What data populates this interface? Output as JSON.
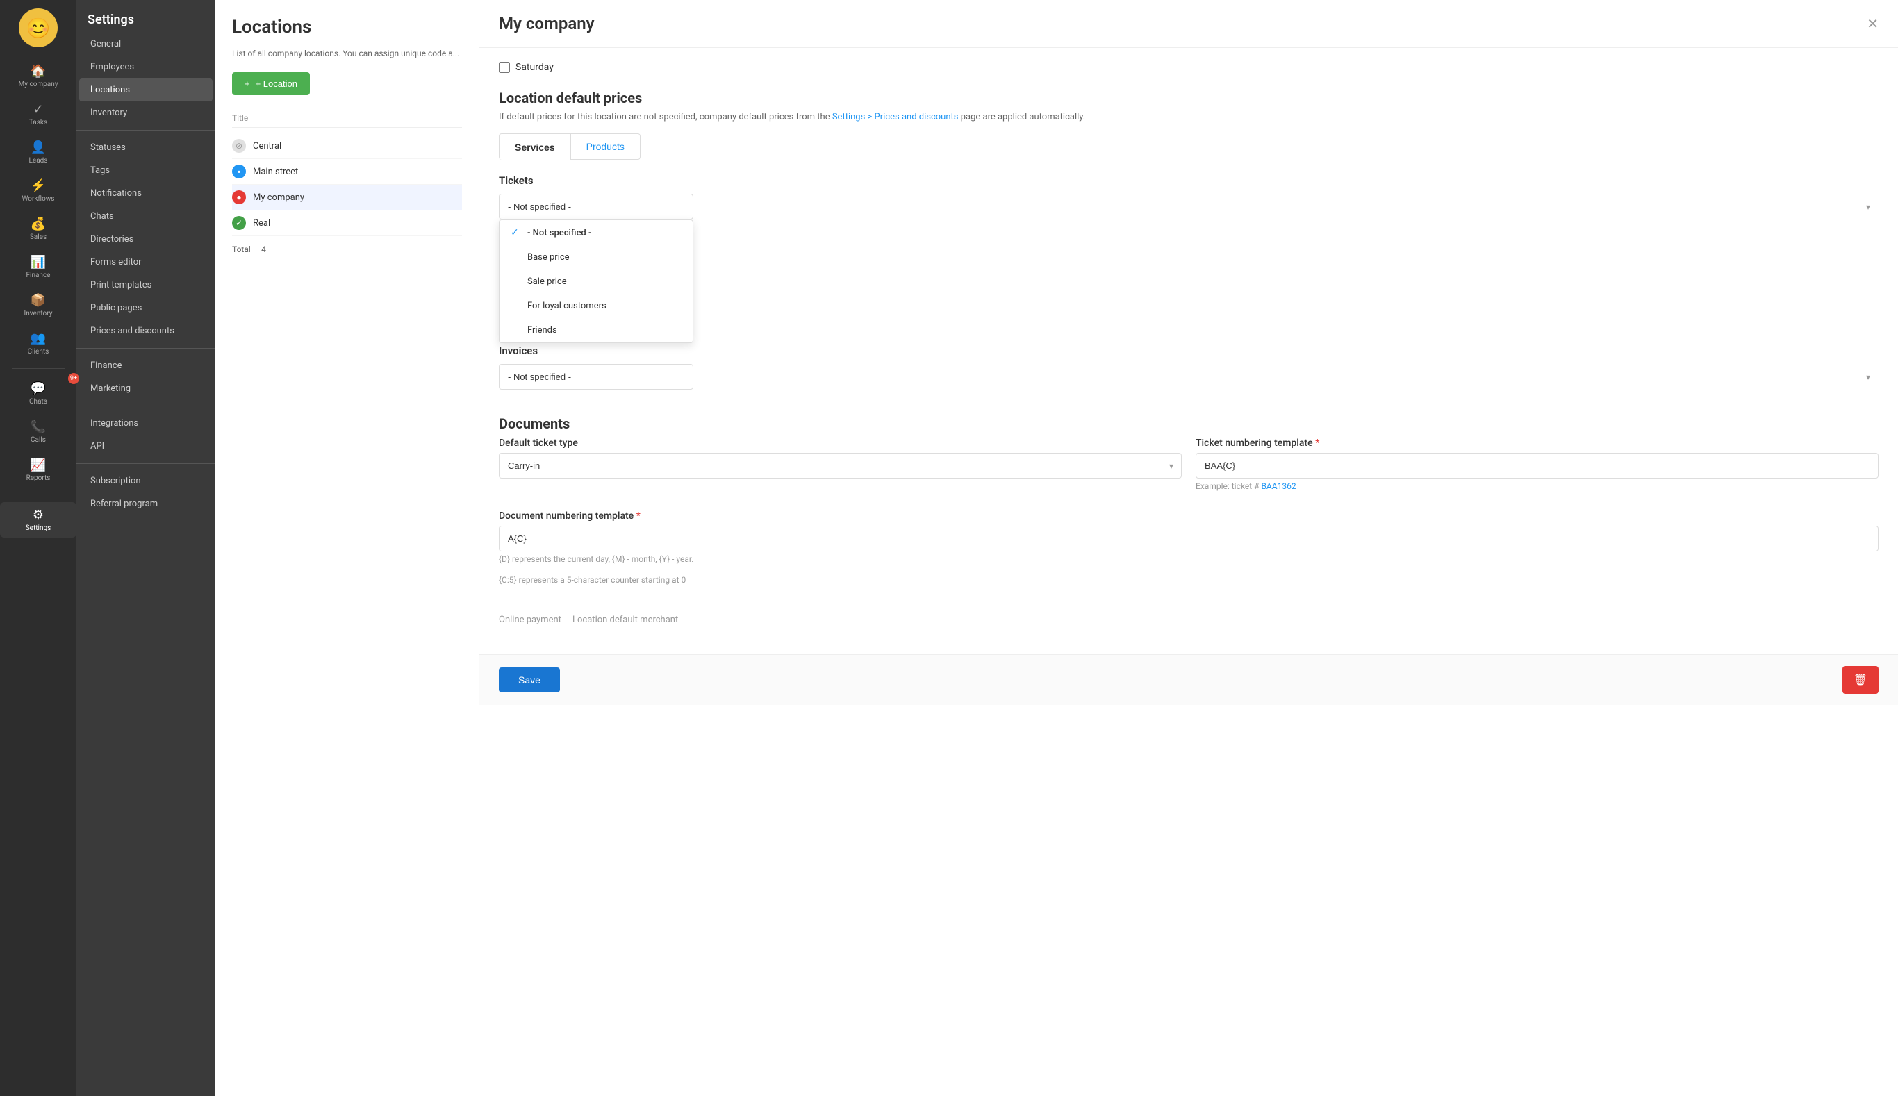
{
  "leftNav": {
    "avatar": "😊",
    "items": [
      {
        "id": "my-company",
        "label": "My company",
        "icon": "🏠",
        "active": false
      },
      {
        "id": "tasks",
        "label": "Tasks",
        "icon": "✓",
        "active": false
      },
      {
        "id": "leads",
        "label": "Leads",
        "icon": "👤",
        "active": false
      },
      {
        "id": "workflows",
        "label": "Workflows",
        "icon": "⚡",
        "active": false
      },
      {
        "id": "sales",
        "label": "Sales",
        "icon": "💰",
        "active": false
      },
      {
        "id": "finance",
        "label": "Finance",
        "icon": "📊",
        "active": false
      },
      {
        "id": "inventory",
        "label": "Inventory",
        "icon": "📦",
        "active": false
      },
      {
        "id": "clients",
        "label": "Clients",
        "icon": "👥",
        "active": false
      },
      {
        "id": "chats",
        "label": "Chats",
        "icon": "💬",
        "active": false,
        "badge": "9+"
      },
      {
        "id": "calls",
        "label": "Calls",
        "icon": "📞",
        "active": false
      },
      {
        "id": "reports",
        "label": "Reports",
        "icon": "📈",
        "active": false
      },
      {
        "id": "settings",
        "label": "Settings",
        "icon": "⚙",
        "active": true
      }
    ]
  },
  "sidebar": {
    "title": "Settings",
    "items": [
      {
        "id": "general",
        "label": "General",
        "active": false
      },
      {
        "id": "employees",
        "label": "Employees",
        "active": false
      },
      {
        "id": "locations",
        "label": "Locations",
        "active": true
      },
      {
        "id": "inventory",
        "label": "Inventory",
        "active": false
      },
      {
        "id": "statuses",
        "label": "Statuses",
        "active": false
      },
      {
        "id": "tags",
        "label": "Tags",
        "active": false
      },
      {
        "id": "notifications",
        "label": "Notifications",
        "active": false
      },
      {
        "id": "chats",
        "label": "Chats",
        "active": false
      },
      {
        "id": "directories",
        "label": "Directories",
        "active": false
      },
      {
        "id": "forms-editor",
        "label": "Forms editor",
        "active": false
      },
      {
        "id": "print-templates",
        "label": "Print templates",
        "active": false
      },
      {
        "id": "public-pages",
        "label": "Public pages",
        "active": false
      },
      {
        "id": "prices-discounts",
        "label": "Prices and discounts",
        "active": false
      },
      {
        "id": "finance",
        "label": "Finance",
        "active": false
      },
      {
        "id": "marketing",
        "label": "Marketing",
        "active": false
      },
      {
        "id": "integrations",
        "label": "Integrations",
        "active": false
      },
      {
        "id": "api",
        "label": "API",
        "active": false
      },
      {
        "id": "subscription",
        "label": "Subscription",
        "active": false
      },
      {
        "id": "referral",
        "label": "Referral program",
        "active": false
      }
    ]
  },
  "locations": {
    "title": "Locations",
    "description": "List of all company locations. You can assign unique code a...",
    "addButton": "+ Location",
    "tableHeader": "Title",
    "rows": [
      {
        "name": "Central",
        "iconType": "gray",
        "icon": "⊘"
      },
      {
        "name": "Main street",
        "iconType": "blue",
        "icon": "▪"
      },
      {
        "name": "My company",
        "iconType": "red",
        "icon": "●"
      },
      {
        "name": "Real",
        "iconType": "green",
        "icon": "✓"
      }
    ],
    "total": "Total — 4"
  },
  "myCompany": {
    "title": "My company",
    "saturday": {
      "label": "Saturday",
      "checked": false
    },
    "defaultPrices": {
      "title": "Location default prices",
      "description": "If default prices for this location are not specified, company default prices from the",
      "linkText": "Settings > Prices and discounts",
      "descriptionEnd": "page are applied automatically.",
      "tabs": [
        {
          "id": "services",
          "label": "Services",
          "active": true
        },
        {
          "id": "products",
          "label": "Products",
          "active": false
        }
      ],
      "tickets": {
        "label": "Tickets",
        "dropdownOpen": true,
        "selected": "- Not specified -",
        "options": [
          {
            "value": "not-specified",
            "label": "- Not specified -",
            "selected": true
          },
          {
            "value": "base-price",
            "label": "Base price",
            "selected": false
          },
          {
            "value": "sale-price",
            "label": "Sale price",
            "selected": false
          },
          {
            "value": "loyal-customers",
            "label": "For loyal customers",
            "selected": false
          },
          {
            "value": "friends",
            "label": "Friends",
            "selected": false
          }
        ]
      },
      "invoices": {
        "label": "Invoices",
        "selected": "- Not specified -"
      }
    },
    "documents": {
      "title": "Documents",
      "defaultTicketType": {
        "label": "Default ticket type",
        "selected": "Carry-in"
      },
      "ticketNumbering": {
        "label": "Ticket numbering template",
        "required": true,
        "value": "BAA{C}",
        "example": "Example: ticket # BAA1362",
        "exampleLink": "BAA1362"
      },
      "documentNumbering": {
        "label": "Document numbering template",
        "required": true,
        "value": "A{C}",
        "hint1": "{D} represents the current day, {M} - month, {Y} - year.",
        "hint2": "{C:5} represents a 5-character counter starting at 0"
      }
    },
    "footer": {
      "saveLabel": "Save",
      "deleteLabel": "🗑"
    }
  }
}
